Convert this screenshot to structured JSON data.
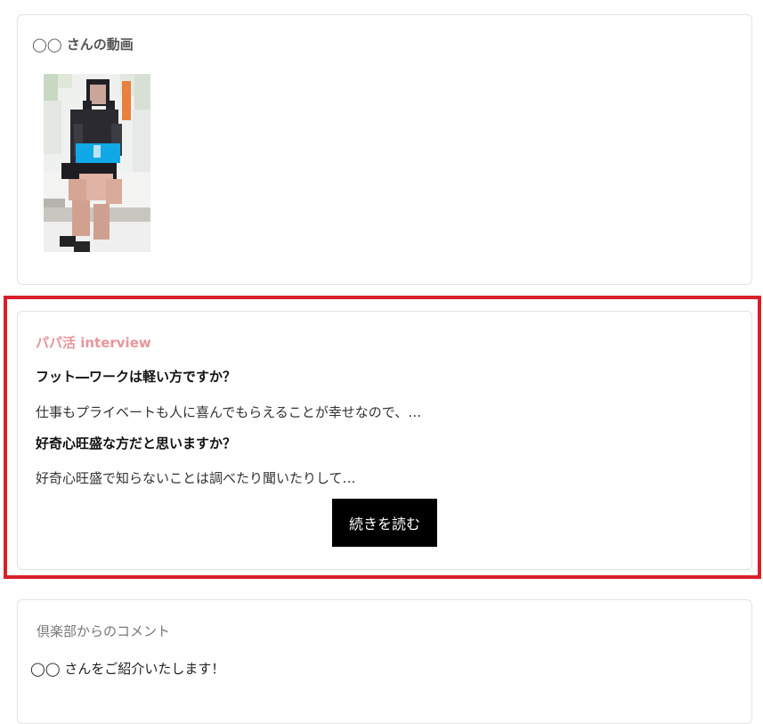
{
  "video_section": {
    "title": "◯◯ さんの動画",
    "thumbnail_description": "pixelated-video-thumbnail"
  },
  "interview_section": {
    "heading": "パパ活 interview",
    "q1": "フット―ワークは軽い方ですか？",
    "a1": "仕事もプライベートも人に喜んでもらえることが幸せなので、…",
    "q2": "好奇心旺盛な方だと思いますか？",
    "a2": "好奇心旺盛で知らないことは調べたり聞いたりして…",
    "read_more_label": "続きを読む",
    "accent_color": "#e8959b",
    "highlight_color": "#d9202a"
  },
  "comment_section": {
    "heading": "倶楽部からのコメント",
    "text": "◯◯ さんをご紹介いたします！"
  }
}
